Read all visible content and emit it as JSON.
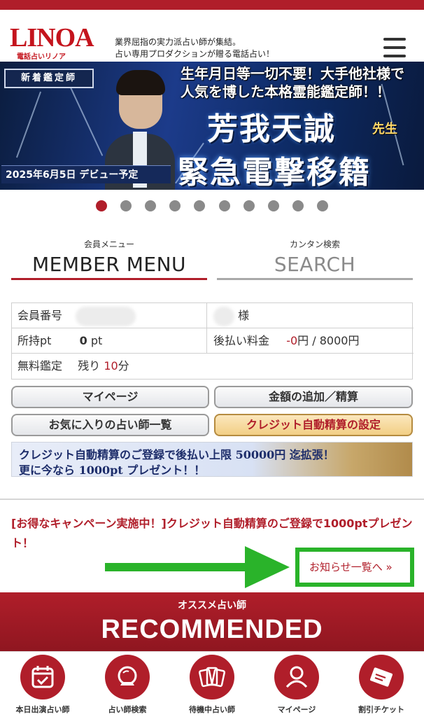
{
  "header": {
    "logo_text": "LINOA",
    "logo_sub": "電話占いリノア",
    "tagline_1": "業界屈指の実力派占い師が集結。",
    "tagline_2": "占い専用プロダクションが贈る電話占い！"
  },
  "banner": {
    "badge": "新着鑑定師",
    "line1": "生年月日等一切不要！大手他社様で",
    "line2": "人気を博した本格霊能鑑定師！！",
    "name": "芳我天誠",
    "sensei": "先生",
    "main": "緊急電撃移籍",
    "debut": "2025年6月5日 デビュー予定"
  },
  "carousel": {
    "total": 10,
    "active": 1
  },
  "tabs": {
    "member_small": "会員メニュー",
    "member_big": "MEMBER MENU",
    "search_small": "カンタン検索",
    "search_big": "SEARCH"
  },
  "account": {
    "member_no_label": "会員番号",
    "sama": "様",
    "points_label": "所持pt",
    "points_value": "0",
    "points_unit": "pt",
    "postpay_label": "後払い料金",
    "postpay_value": "-0",
    "postpay_rest": "円 / 8000円",
    "free_label": "無料鑑定",
    "free_remaining_label": "残り",
    "free_minutes": "10",
    "free_unit": "分"
  },
  "buttons": {
    "mypage": "マイページ",
    "add_amount": "金額の追加／精算",
    "favorites": "お気に入りの占い師一覧",
    "credit_setting": "クレジット自動精算の設定"
  },
  "credit_banner": {
    "line1": "クレジット自動精算のご登録で後払い上限 50000円 迄拡張！",
    "line2": "更に今なら 1000pt プレゼント！！"
  },
  "campaign": {
    "text": "[お得なキャンペーン実施中！]クレジット自動精算のご登録で1000ptプレゼント！"
  },
  "news": {
    "link": "お知らせ一覧へ »"
  },
  "recommended": {
    "small": "オススメ占い師",
    "big": "RECOMMENDED"
  },
  "bottom_nav": [
    {
      "label": "本日出演占い師",
      "icon": "calendar-check-icon"
    },
    {
      "label": "占い師検索",
      "icon": "crystal-ball-icon"
    },
    {
      "label": "待機中占い師",
      "icon": "tarot-cards-icon"
    },
    {
      "label": "マイページ",
      "icon": "user-icon"
    },
    {
      "label": "割引チケット",
      "icon": "ticket-icon"
    }
  ],
  "colors": {
    "brand": "#b01e2a",
    "highlight": "#2ab32a"
  }
}
